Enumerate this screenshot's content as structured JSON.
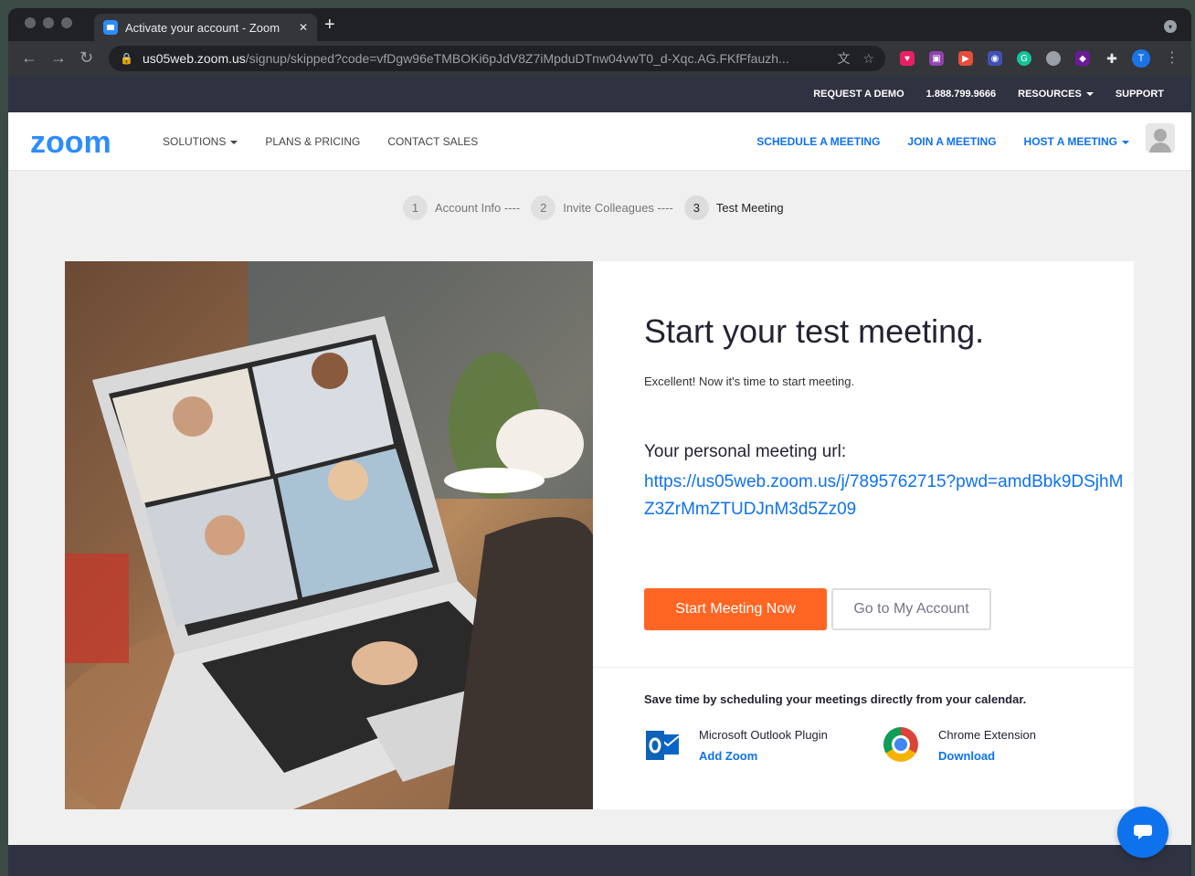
{
  "browser": {
    "tab_title": "Activate your account - Zoom",
    "url_host": "us05web.zoom.us",
    "url_path": "/signup/skipped?code=vfDgw96eTMBOKi6pJdV8Z7iMpduDTnw04vwT0_d-Xqc.AG.FKfFfauzh...",
    "profile_initial": "T"
  },
  "topbar": {
    "request_demo": "REQUEST A DEMO",
    "phone": "1.888.799.9666",
    "resources": "RESOURCES",
    "support": "SUPPORT"
  },
  "nav": {
    "logo": "zoom",
    "solutions": "SOLUTIONS",
    "plans": "PLANS & PRICING",
    "contact": "CONTACT SALES",
    "schedule": "SCHEDULE A MEETING",
    "join": "JOIN A MEETING",
    "host": "HOST A MEETING"
  },
  "steps": [
    {
      "num": "1",
      "label": "Account Info ----"
    },
    {
      "num": "2",
      "label": "Invite Colleagues ----"
    },
    {
      "num": "3",
      "label": "Test Meeting"
    }
  ],
  "card": {
    "title": "Start your test meeting.",
    "subtitle": "Excellent! Now it's time to start meeting.",
    "url_label": "Your personal meeting url:",
    "url": "https://us05web.zoom.us/j/7895762715?pwd=amdBbk9DSjhMZ3ZrMmZTUDJnM3d5Zz09",
    "start_btn": "Start Meeting Now",
    "account_btn": "Go to My Account",
    "calendar_note": "Save time by scheduling your meetings directly from your calendar.",
    "plugins": [
      {
        "name": "Microsoft Outlook Plugin",
        "link": "Add Zoom"
      },
      {
        "name": "Chrome Extension",
        "link": "Download"
      }
    ]
  },
  "colors": {
    "brand_blue": "#2d8cff",
    "link_blue": "#0e72ed",
    "cta_orange": "#ff6624",
    "topbar": "#2f3240"
  }
}
